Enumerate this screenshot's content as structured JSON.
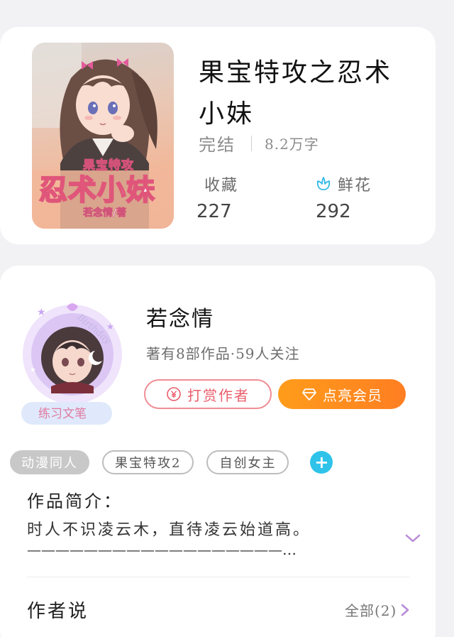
{
  "book": {
    "title": "果宝特攻之忍术小妹",
    "status": "完结",
    "word_count": "8.2万字",
    "cover": {
      "series_text": "果宝特攻",
      "title_text": "忍术小妹",
      "author_text": "若念情/著"
    },
    "stats": {
      "favorites_label": "收藏",
      "favorites_value": "227",
      "flowers_label": "鲜花",
      "flowers_value": "292"
    }
  },
  "author": {
    "name": "若念情",
    "info": "著有8部作品·59人关注",
    "badge_text": "练习文笔",
    "avatar_deco_text": "Birthday",
    "tip_button_label": "打赏作者",
    "vip_button_label": "点亮会员"
  },
  "tags": [
    "动漫同人",
    "果宝特攻2",
    "自创女主"
  ],
  "intro": {
    "heading": "作品简介：",
    "text": "时人不识凌云木，直待凌云始道高。",
    "continuation": "——————————————————…"
  },
  "author_says": {
    "heading": "作者说",
    "all_label": "全部(2)"
  },
  "colors": {
    "accent_orange": "#ff8a1f",
    "tip_red": "#ea5e6b",
    "flower_blue": "#2fb8e6",
    "expand_purple": "#b98ad8"
  },
  "icons": [
    "flower-icon",
    "yen-circle-icon",
    "diamond-icon",
    "plus-icon",
    "chevron-down-icon",
    "chevron-right-icon"
  ]
}
